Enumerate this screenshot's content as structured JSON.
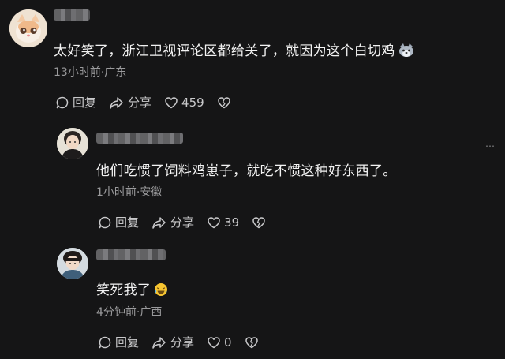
{
  "comments": [
    {
      "text": "太好笑了，浙江卫视评论区都给关了，就因为这个白切鸡",
      "meta": "13小时前·广东",
      "reply_label": "回复",
      "share_label": "分享",
      "like_count": "459",
      "avatar_icon": "cat-avatar",
      "trailing_emoji": "wolf-emoji"
    },
    {
      "text": "他们吃惯了饲料鸡崽子，就吃不惯这种好东西了。",
      "meta": "1小时前·安徽",
      "reply_label": "回复",
      "share_label": "分享",
      "like_count": "39",
      "avatar_icon": "person-avatar"
    },
    {
      "text": "笑死我了",
      "meta": "4分钟前·广西",
      "reply_label": "回复",
      "share_label": "分享",
      "like_count": "0",
      "avatar_icon": "person-avatar",
      "trailing_emoji": "laughing-tears-emoji"
    }
  ],
  "more_icon": "ellipsis-icon",
  "colors": {
    "background": "#151516",
    "text": "#f2f2f2",
    "meta": "#9a9a9c",
    "action": "#c9c9cb"
  }
}
